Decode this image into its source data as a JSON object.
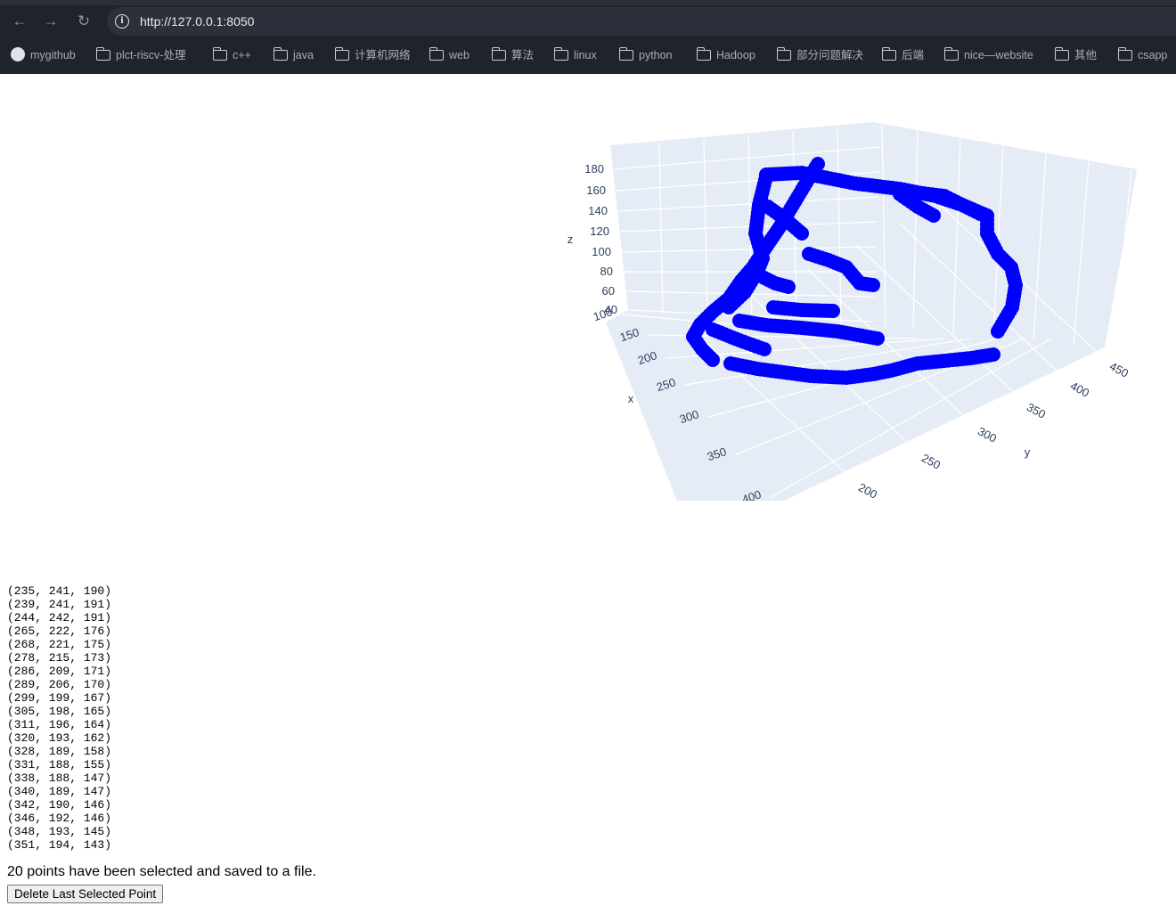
{
  "browser": {
    "url": "http://127.0.0.1:8050",
    "bookmarks": [
      "mygithub",
      "plct-riscv-处理",
      "c++",
      "java",
      "计算机网络",
      "web",
      "算法",
      "linux",
      "python",
      "Hadoop",
      "部分问题解决",
      "后端",
      "nice—website",
      "其他",
      "csapp"
    ]
  },
  "chart_data": {
    "type": "scatter3d",
    "marker_color": "#0000ff",
    "background": "#e5ecf6",
    "axes": {
      "x": {
        "label": "x",
        "ticks": [
          "100",
          "150",
          "200",
          "250",
          "300",
          "350",
          "400"
        ]
      },
      "y": {
        "label": "y",
        "ticks": [
          "200",
          "250",
          "300",
          "350",
          "400",
          "450"
        ]
      },
      "z": {
        "label": "z",
        "ticks": [
          "40",
          "60",
          "80",
          "100",
          "120",
          "140",
          "160",
          "180"
        ]
      }
    }
  },
  "selected_points": [
    "(235, 241, 190)",
    "(239, 241, 191)",
    "(244, 242, 191)",
    "(265, 222, 176)",
    "(268, 221, 175)",
    "(278, 215, 173)",
    "(286, 209, 171)",
    "(289, 206, 170)",
    "(299, 199, 167)",
    "(305, 198, 165)",
    "(311, 196, 164)",
    "(320, 193, 162)",
    "(328, 189, 158)",
    "(331, 188, 155)",
    "(338, 188, 147)",
    "(340, 189, 147)",
    "(342, 190, 146)",
    "(346, 192, 146)",
    "(348, 193, 145)",
    "(351, 194, 143)"
  ],
  "status_message": "20 points have been selected and saved to a file.",
  "delete_button_label": "Delete Last Selected Point"
}
